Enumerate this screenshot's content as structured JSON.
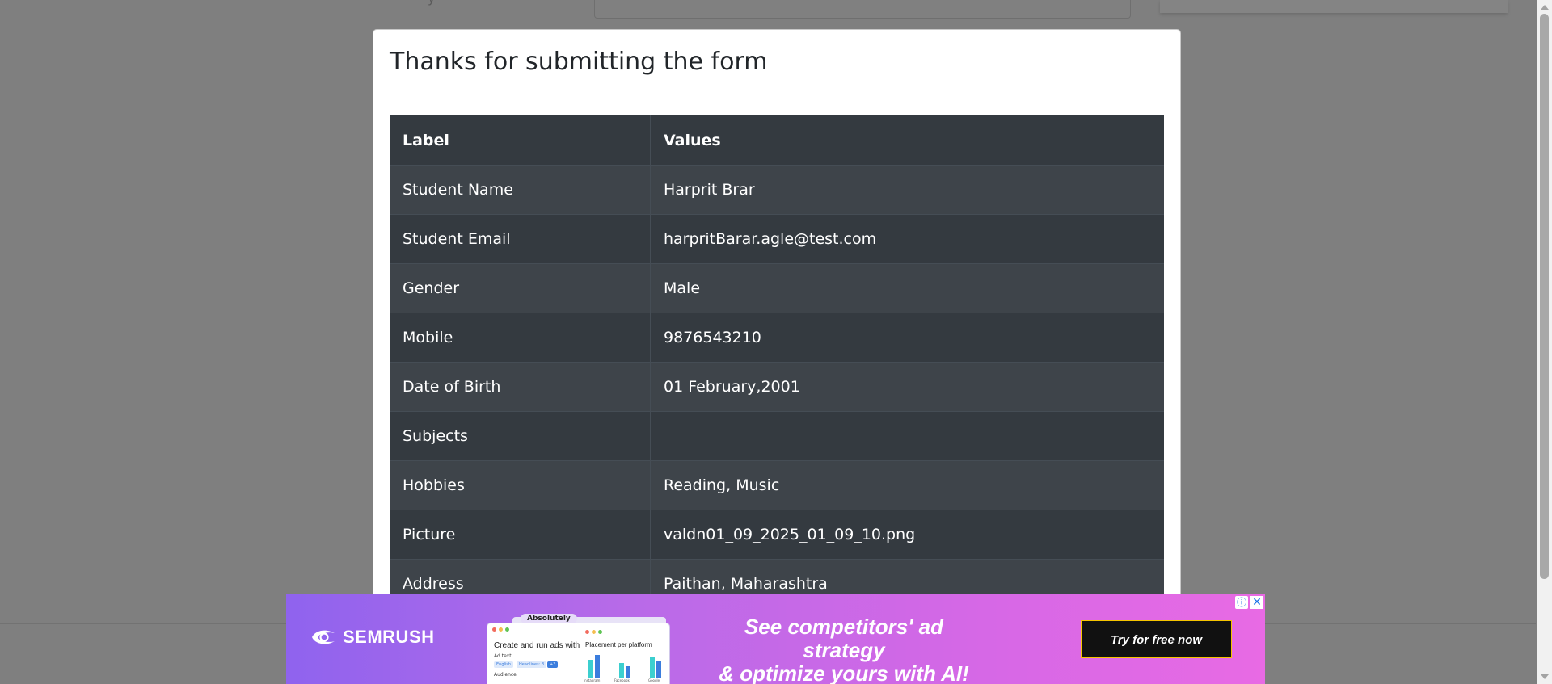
{
  "background": {
    "partial_label": "y"
  },
  "modal": {
    "title": "Thanks for submitting the form",
    "table": {
      "headers": [
        "Label",
        "Values"
      ],
      "rows": [
        {
          "label": "Student Name",
          "value": "Harprit Brar"
        },
        {
          "label": "Student Email",
          "value": "harpritBarar.agle@test.com"
        },
        {
          "label": "Gender",
          "value": "Male"
        },
        {
          "label": "Mobile",
          "value": "9876543210"
        },
        {
          "label": "Date of Birth",
          "value": "01 February,2001"
        },
        {
          "label": "Subjects",
          "value": ""
        },
        {
          "label": "Hobbies",
          "value": "Reading, Music"
        },
        {
          "label": "Picture",
          "value": "valdn01_09_2025_01_09_10.png"
        },
        {
          "label": "Address",
          "value": "Paithan, Maharashtra"
        }
      ]
    }
  },
  "ad": {
    "brand": "SEMRUSH",
    "bubble": "Absolutely",
    "mock_title": "Create and run ads with",
    "mock_sub1": "Ad text",
    "mock_chips": [
      "English",
      "Headlines: 3",
      "+3"
    ],
    "mock_sub2": "Audience",
    "panel_title": "Placement per platform",
    "panel_axis": [
      "Instagram",
      "Facebook",
      "Google"
    ],
    "headline_line1": "See competitors' ad strategy",
    "headline_line2": "& optimize yours with AI!",
    "cta": "Try for free now",
    "info_icon": "info-icon",
    "close_icon": "close-icon"
  },
  "colors": {
    "overlay": "#7f7f7f",
    "table_dark": "#343a40",
    "table_stripe": "#3e444a",
    "ad_gradient_start": "#8f63ee",
    "ad_gradient_end": "#e86ae4",
    "cta_border": "#f5c400"
  }
}
